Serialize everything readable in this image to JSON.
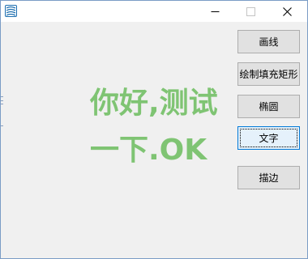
{
  "window": {
    "title": "",
    "controls": {
      "minimize_icon": "minimize-icon",
      "maximize_icon": "maximize-icon",
      "close_icon": "close-icon"
    }
  },
  "canvas": {
    "line1": "你好,测试",
    "line2": "一下.OK",
    "text_color": "#7fc473"
  },
  "buttons": {
    "draw_line": "画线",
    "fill_rect": "绘制填充矩形",
    "ellipse": "椭圆",
    "text": "文字",
    "stroke": "描边"
  },
  "colors": {
    "window_border": "#7a9cc6",
    "focus_border": "#0078d7"
  }
}
